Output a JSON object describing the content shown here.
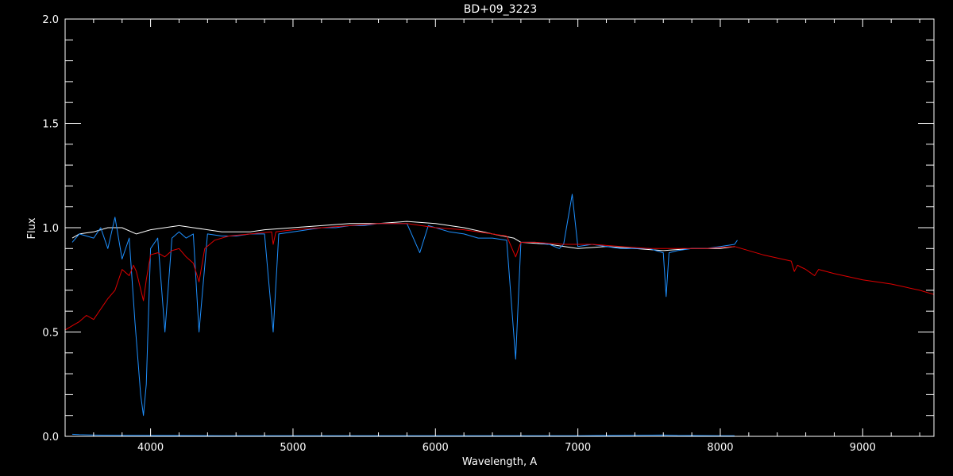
{
  "chart_data": {
    "type": "line",
    "title": "BD+09_3223",
    "xlabel": "Wavelength, A",
    "ylabel": "Flux",
    "xlim": [
      3400,
      9500
    ],
    "ylim": [
      0.0,
      2.0
    ],
    "x_ticks": [
      4000,
      5000,
      6000,
      7000,
      8000,
      9000
    ],
    "x_tick_labels": [
      "4000",
      "5000",
      "6000",
      "7000",
      "8000",
      "9000"
    ],
    "x_minor_step": 200,
    "y_ticks": [
      0.0,
      0.5,
      1.0,
      1.5,
      2.0
    ],
    "y_tick_labels": [
      "0.0",
      "0.5",
      "1.0",
      "1.5",
      "2.0"
    ],
    "y_minor_step": 0.1,
    "grid": false,
    "background": "#000000",
    "axis_color": "#ffffff",
    "series": [
      {
        "color": "#ffffff",
        "x": [
          3450,
          3500,
          3600,
          3700,
          3800,
          3900,
          4000,
          4100,
          4200,
          4300,
          4400,
          4500,
          4600,
          4700,
          4800,
          5000,
          5200,
          5400,
          5600,
          5800,
          6000,
          6200,
          6400,
          6550,
          6600,
          6800,
          7000,
          7200,
          7400,
          7600,
          7800,
          8000,
          8100
        ],
        "y": [
          0.95,
          0.97,
          0.98,
          1.0,
          1.0,
          0.97,
          0.99,
          1.0,
          1.01,
          1.0,
          0.99,
          0.98,
          0.98,
          0.98,
          0.99,
          1.0,
          1.01,
          1.02,
          1.02,
          1.03,
          1.02,
          1.0,
          0.97,
          0.95,
          0.93,
          0.92,
          0.9,
          0.91,
          0.9,
          0.89,
          0.9,
          0.9,
          0.91
        ]
      },
      {
        "color": "#1e90ff",
        "x": [
          3450,
          3500,
          3600,
          3650,
          3700,
          3750,
          3800,
          3850,
          3890,
          3930,
          3950,
          3970,
          4000,
          4050,
          4101,
          4150,
          4200,
          4250,
          4300,
          4340,
          4400,
          4500,
          4600,
          4700,
          4800,
          4861,
          4900,
          5000,
          5100,
          5200,
          5300,
          5400,
          5500,
          5600,
          5700,
          5800,
          5890,
          5950,
          6000,
          6100,
          6200,
          6300,
          6400,
          6500,
          6563,
          6600,
          6700,
          6800,
          6870,
          6900,
          6960,
          7000,
          7100,
          7200,
          7300,
          7400,
          7500,
          7600,
          7620,
          7640,
          7700,
          7800,
          7900,
          8000,
          8100,
          8120
        ],
        "y": [
          0.93,
          0.97,
          0.95,
          1.0,
          0.9,
          1.05,
          0.85,
          0.95,
          0.55,
          0.2,
          0.1,
          0.25,
          0.9,
          0.95,
          0.5,
          0.95,
          0.98,
          0.95,
          0.97,
          0.5,
          0.97,
          0.96,
          0.96,
          0.97,
          0.97,
          0.5,
          0.97,
          0.98,
          0.99,
          1.0,
          1.0,
          1.01,
          1.01,
          1.02,
          1.02,
          1.02,
          0.88,
          1.01,
          1.0,
          0.98,
          0.97,
          0.95,
          0.95,
          0.94,
          0.37,
          0.93,
          0.93,
          0.92,
          0.9,
          0.92,
          1.16,
          0.91,
          0.92,
          0.91,
          0.9,
          0.9,
          0.9,
          0.88,
          0.67,
          0.88,
          0.89,
          0.9,
          0.9,
          0.91,
          0.92,
          0.94
        ]
      },
      {
        "color": "#e00000",
        "x": [
          3400,
          3450,
          3500,
          3550,
          3600,
          3650,
          3700,
          3750,
          3800,
          3850,
          3880,
          3900,
          3950,
          3970,
          4000,
          4050,
          4100,
          4150,
          4200,
          4250,
          4300,
          4340,
          4380,
          4450,
          4550,
          4700,
          4850,
          4861,
          4880,
          5000,
          5200,
          5400,
          5600,
          5800,
          6000,
          6200,
          6400,
          6500,
          6563,
          6600,
          6700,
          6900,
          7100,
          7300,
          7500,
          7700,
          7900,
          8100,
          8300,
          8498,
          8520,
          8542,
          8570,
          8600,
          8662,
          8690,
          8800,
          9000,
          9200,
          9400,
          9500
        ],
        "y": [
          0.51,
          0.53,
          0.55,
          0.58,
          0.56,
          0.61,
          0.66,
          0.7,
          0.8,
          0.77,
          0.82,
          0.79,
          0.65,
          0.75,
          0.87,
          0.88,
          0.86,
          0.89,
          0.9,
          0.86,
          0.83,
          0.74,
          0.9,
          0.94,
          0.96,
          0.97,
          0.98,
          0.92,
          0.98,
          0.99,
          1.0,
          1.01,
          1.02,
          1.02,
          1.0,
          0.99,
          0.97,
          0.96,
          0.86,
          0.93,
          0.93,
          0.92,
          0.92,
          0.91,
          0.9,
          0.9,
          0.9,
          0.91,
          0.87,
          0.84,
          0.79,
          0.82,
          0.81,
          0.8,
          0.77,
          0.8,
          0.78,
          0.75,
          0.73,
          0.7,
          0.68
        ]
      },
      {
        "color": "#1e90ff",
        "x": [
          3450,
          3500,
          3600,
          3800,
          4000,
          4500,
          5000,
          6000,
          7000,
          7600,
          7700,
          8000,
          8100
        ],
        "y": [
          0.01,
          0.008,
          0.006,
          0.005,
          0.004,
          0.003,
          0.003,
          0.003,
          0.003,
          0.006,
          0.004,
          0.003,
          0.003
        ]
      }
    ]
  }
}
